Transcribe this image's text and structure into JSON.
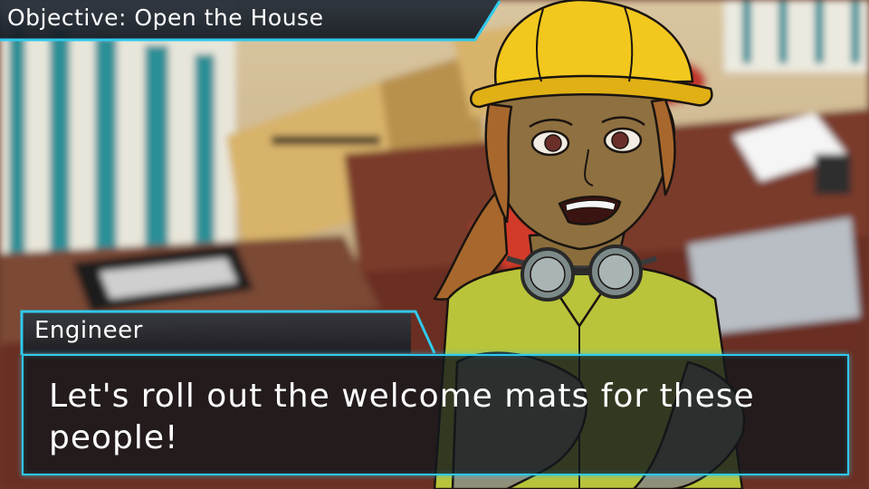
{
  "hud": {
    "objective": "Objective: Open the House"
  },
  "dialog": {
    "speaker": "Engineer",
    "line": "Let's roll out the welcome mats for these people!"
  },
  "colors": {
    "accent": "#2fc9ec",
    "panel": "#161c24",
    "text": "#ffffff",
    "hardhat": "#f2c81e",
    "shirt": "#b9c43a"
  },
  "icons": {
    "character": "engineer-character",
    "goggles": "goggles-icon"
  }
}
